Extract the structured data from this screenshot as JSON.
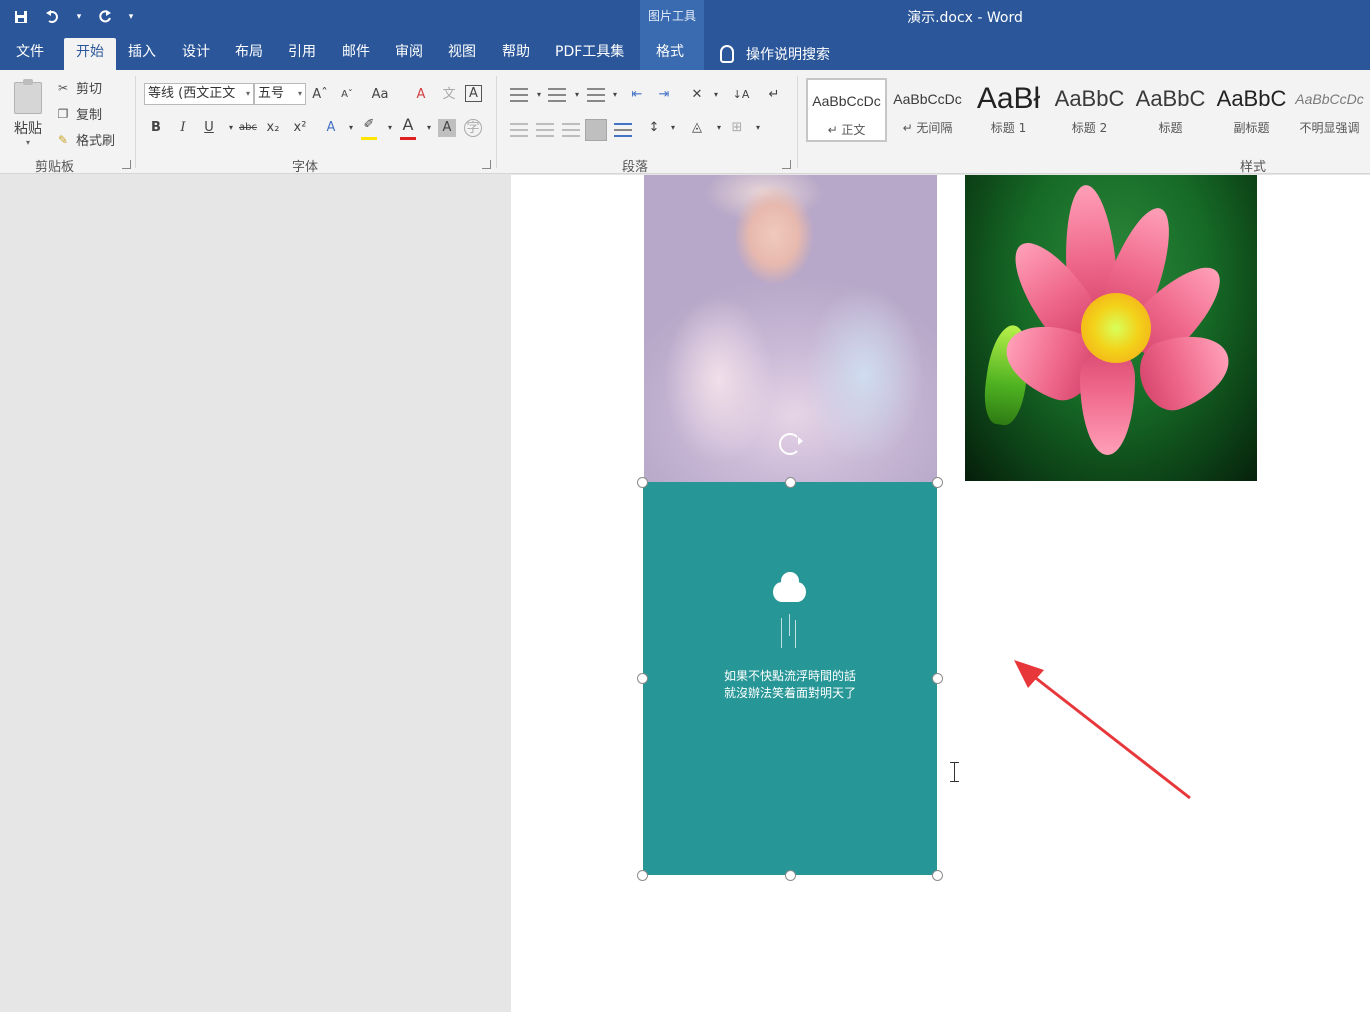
{
  "window": {
    "doc_title": "演示.docx  -  Word",
    "context_group": "图片工具"
  },
  "qat": {
    "save_icon": "save-icon",
    "undo_icon": "undo-icon",
    "redo_icon": "redo-icon"
  },
  "tabs": [
    {
      "label": "文件"
    },
    {
      "label": "开始"
    },
    {
      "label": "插入"
    },
    {
      "label": "设计"
    },
    {
      "label": "布局"
    },
    {
      "label": "引用"
    },
    {
      "label": "邮件"
    },
    {
      "label": "审阅"
    },
    {
      "label": "视图"
    },
    {
      "label": "帮助"
    },
    {
      "label": "PDF工具集"
    },
    {
      "label": "格式"
    }
  ],
  "tell_me": "操作说明搜索",
  "clipboard": {
    "paste": "粘贴",
    "cut": "剪切",
    "copy": "复制",
    "format_painter": "格式刷",
    "group_label": "剪贴板"
  },
  "font": {
    "font_name": "等线 (西文正文",
    "font_size": "五号",
    "group_label": "字体",
    "grow": "Aˆ",
    "shrink": "Aˇ",
    "change_case": "Aa",
    "bold": "B",
    "italic": "I",
    "underline": "U",
    "strike": "abc",
    "subscript": "x₂",
    "superscript": "x²"
  },
  "paragraph": {
    "group_label": "段落"
  },
  "styles": {
    "group_label": "样式",
    "items": [
      {
        "sample": "AaBbCcDc",
        "name": "↵ 正文"
      },
      {
        "sample": "AaBbCcDc",
        "name": "↵ 无间隔"
      },
      {
        "sample": "AaBł",
        "name": "标题 1"
      },
      {
        "sample": "AaBbC",
        "name": "标题 2"
      },
      {
        "sample": "AaBbC",
        "name": "标题"
      },
      {
        "sample": "AaBbC",
        "name": "副标题"
      },
      {
        "sample": "AaBbCcDc",
        "name": "不明显强调"
      }
    ]
  },
  "document": {
    "teal_image_text_line1": "如果不快點流浮時間的話",
    "teal_image_text_line2": "就沒辦法笑着面對明天了"
  },
  "colors": {
    "accent": "#2b579a",
    "teal": "#279696",
    "arrow": "#e8373a"
  }
}
